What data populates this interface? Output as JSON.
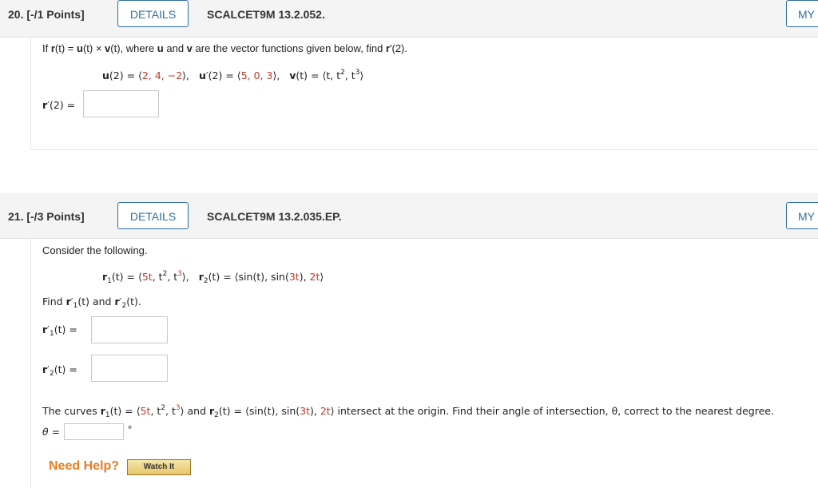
{
  "q20": {
    "number": "20.",
    "points": "[-/1 Points]",
    "details_label": "DETAILS",
    "code": "SCALCET9M 13.2.052.",
    "my_label": "MY",
    "prompt_a": "If ",
    "prompt_b": "r",
    "prompt_c": "(t) = ",
    "prompt_d": "u",
    "prompt_e": "(t) × ",
    "prompt_f": "v",
    "prompt_g": "(t), where ",
    "prompt_h": "u",
    "prompt_i": " and ",
    "prompt_j": "v",
    "prompt_k": " are the vector functions given below, find ",
    "prompt_l": "r",
    "prompt_m": "′(2).",
    "given": {
      "u2_label": "u",
      "u2_rest": "(2) = ⟨",
      "u2_vals": "2, 4, −2",
      "u2_close": "⟩,",
      "up2_label": "u",
      "up2_rest": "′(2) = ⟨",
      "up2_vals": "5, 0, 3",
      "up2_close": "⟩,",
      "v_label": "v",
      "v_rest": "(t) = ⟨t, t",
      "v_sq": "2",
      "v_mid": ", t",
      "v_cu": "3",
      "v_close": "⟩"
    },
    "answer_label_r": "r",
    "answer_label_rest": "′(2) ="
  },
  "q21": {
    "number": "21.",
    "points": "[-/3 Points]",
    "details_label": "DETAILS",
    "code": "SCALCET9M 13.2.035.EP.",
    "my_label": "MY",
    "consider": "Consider the following.",
    "r1_label": "r",
    "r1_sub": "1",
    "r1_eq": "(t) = ⟨",
    "r1_a": "5t",
    "r1_b": ", t",
    "r1_b2": "2",
    "r1_c": ", t",
    "r1_c3": "3",
    "r1_close": "⟩,",
    "r2_label": "r",
    "r2_sub": "2",
    "r2_eq": "(t) = ⟨sin(t), sin(",
    "r2_3t": "3t",
    "r2_mid": "), ",
    "r2_2t": "2t",
    "r2_close": "⟩",
    "find_a": "Find ",
    "find_r1": "r",
    "find_p1": "′",
    "find_s1": "1",
    "find_t1": "(t) and ",
    "find_r2": "r",
    "find_p2": "′",
    "find_s2": "2",
    "find_t2": "(t).",
    "ans1_r": "r",
    "ans1_p": "′",
    "ans1_s": "1",
    "ans1_rest": "(t)  =",
    "ans2_r": "r",
    "ans2_p": "′",
    "ans2_s": "2",
    "ans2_rest": "(t)  =",
    "curves_a": "The curves ",
    "curves_r1": "r",
    "curves_s1": "1",
    "curves_eq1": "(t) = ⟨",
    "curves_5t": "5t",
    "curves_t2": ", t",
    "curves_2": "2",
    "curves_t3": ", t",
    "curves_3": "3",
    "curves_close1": "⟩ and ",
    "curves_r2": "r",
    "curves_s2": "2",
    "curves_eq2": "(t) = ⟨sin(t), sin(",
    "curves_3t": "3t",
    "curves_mid": "), ",
    "curves_2t": "2t",
    "curves_tail": "⟩ intersect at the origin. Find their angle of intersection, θ, correct to the nearest degree.",
    "theta_label": "θ =",
    "degree": "°",
    "need_help": "Need Help?",
    "watch_it": "Watch It"
  }
}
